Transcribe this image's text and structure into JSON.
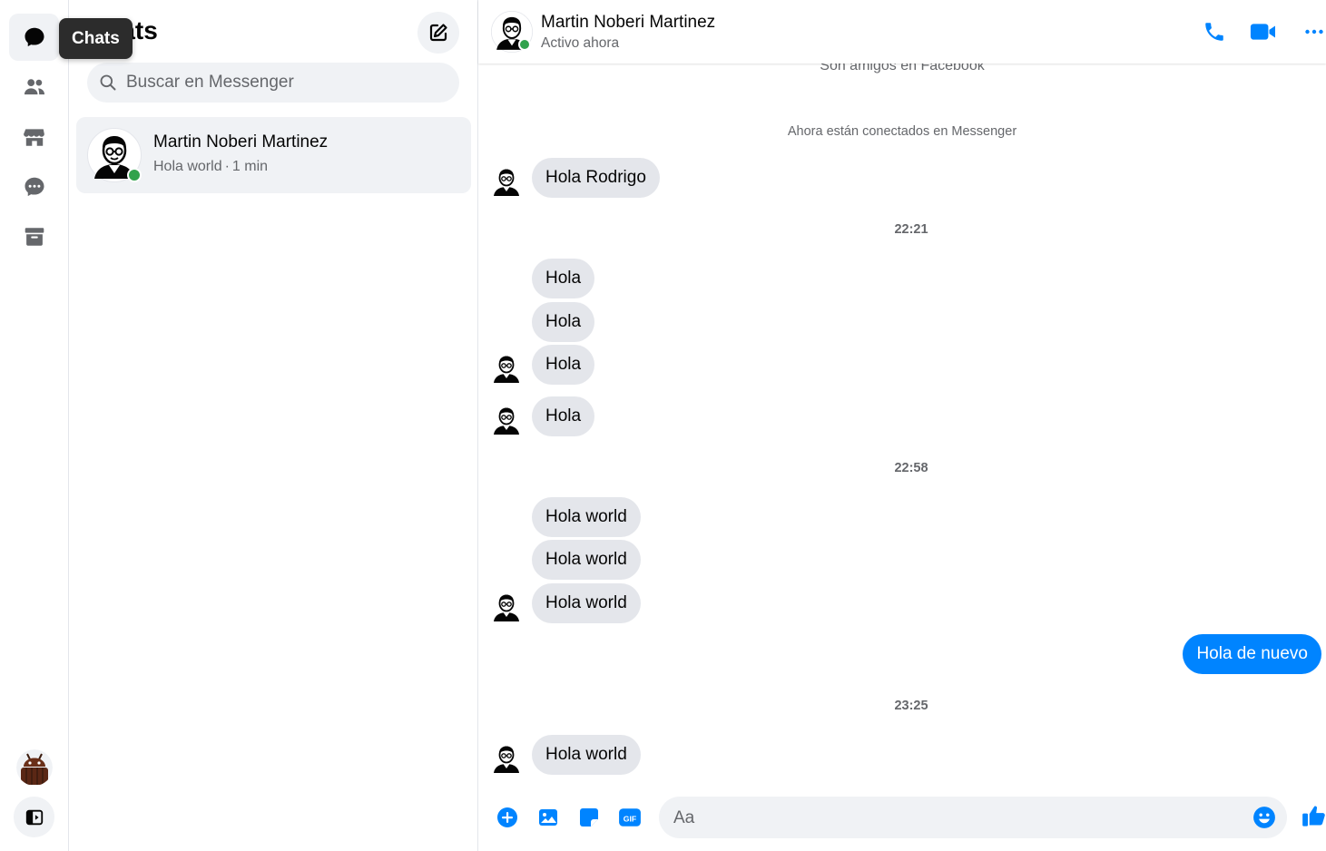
{
  "colors": {
    "accent": "#0084ff",
    "online": "#31a24c",
    "bubble_in": "#e4e6eb",
    "panel_bg": "#f0f2f5"
  },
  "rail": {
    "tooltip": "Chats",
    "items": [
      {
        "name": "chats",
        "icon": "chat-bubble-icon",
        "active": true
      },
      {
        "name": "people",
        "icon": "people-icon"
      },
      {
        "name": "marketplace",
        "icon": "store-icon"
      },
      {
        "name": "requests",
        "icon": "message-requests-icon"
      },
      {
        "name": "archived",
        "icon": "archive-icon"
      }
    ]
  },
  "list": {
    "title": "Chats",
    "search_placeholder": "Buscar en Messenger",
    "conversations": [
      {
        "name": "Martin Noberi Martinez",
        "last_message": "Hola world",
        "time": "1 min"
      }
    ]
  },
  "chat": {
    "contact_name": "Martin Noberi Martinez",
    "status": "Activo ahora",
    "system_friends": "Son amigos en Facebook",
    "system_connected": "Ahora están conectados en Messenger",
    "messages": [
      {
        "text": "Hola Rodrigo",
        "dir": "in"
      },
      {
        "time": "22:21"
      },
      {
        "text": "Hola",
        "dir": "in"
      },
      {
        "text": "Hola",
        "dir": "in"
      },
      {
        "text": "Hola",
        "dir": "in"
      },
      {
        "text": "Hola",
        "dir": "in"
      },
      {
        "time": "22:58"
      },
      {
        "text": "Hola world",
        "dir": "in"
      },
      {
        "text": "Hola world",
        "dir": "in"
      },
      {
        "text": "Hola world",
        "dir": "in"
      },
      {
        "text": "Hola de nuevo",
        "dir": "out"
      },
      {
        "time": "23:25"
      },
      {
        "text": "Hola world",
        "dir": "in"
      }
    ],
    "composer_placeholder": "Aa",
    "composer_icons": [
      "plus-icon",
      "photo-icon",
      "sticker-icon",
      "gif-icon",
      "emoji-icon",
      "like-icon"
    ]
  }
}
